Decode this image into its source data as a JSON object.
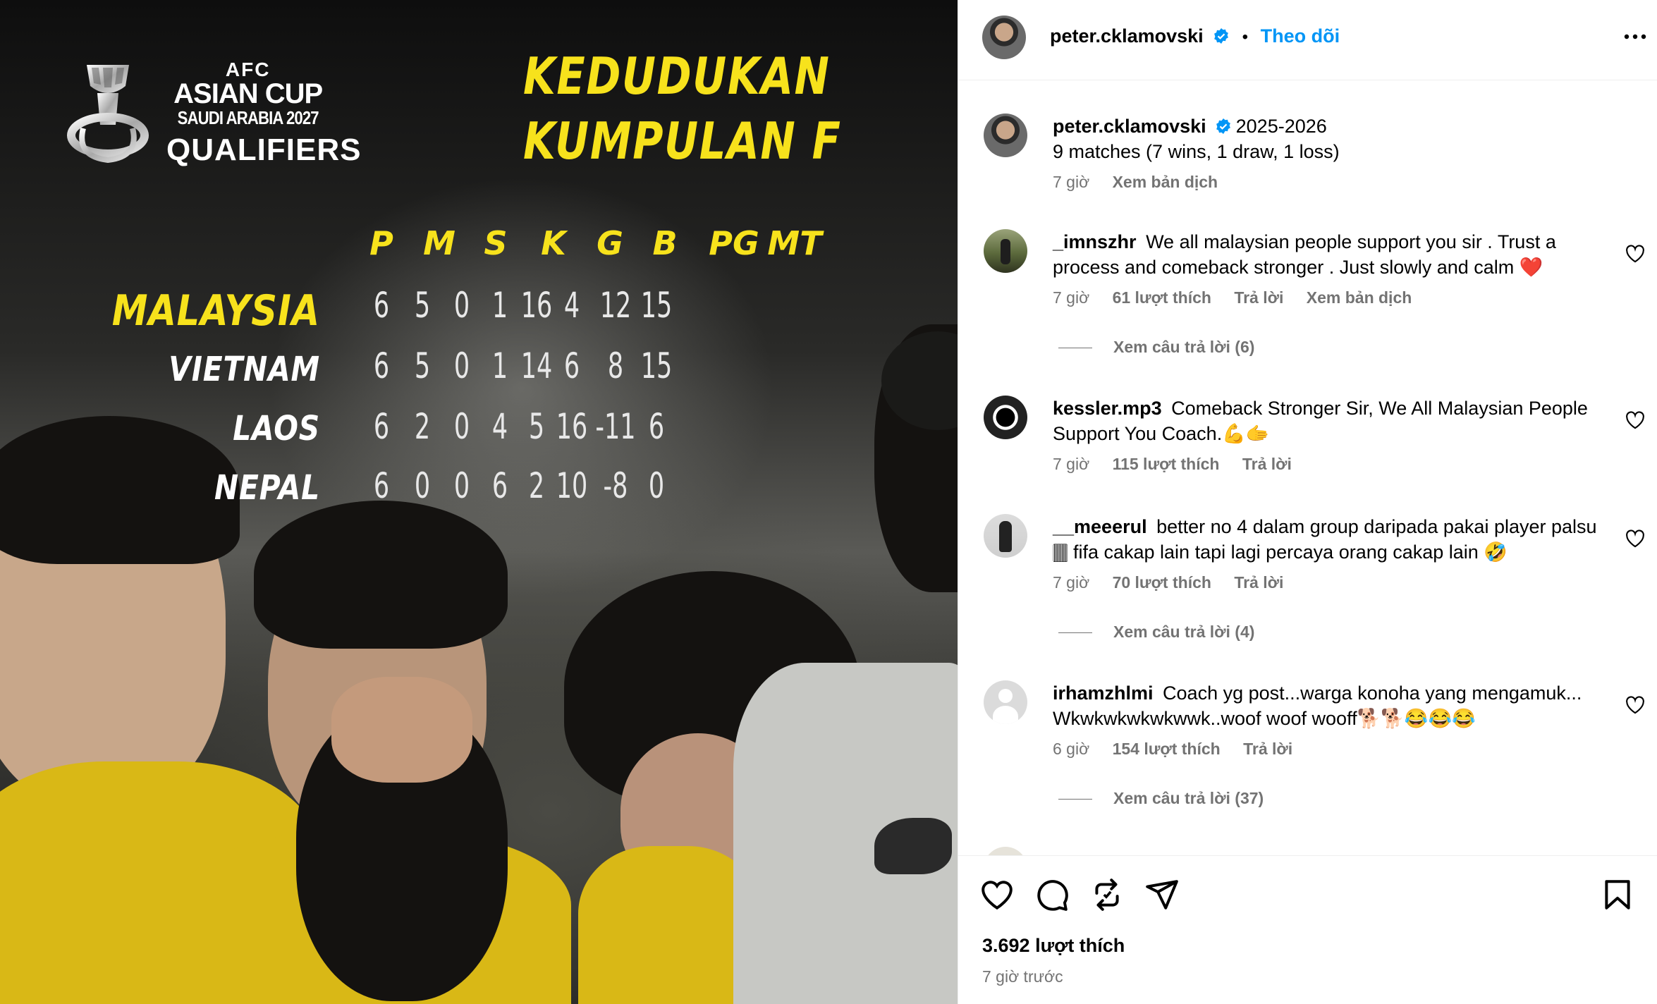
{
  "image": {
    "logo": {
      "afc": "AFC",
      "asian_cup": "ASIAN CUP",
      "host": "SAUDI ARABIA 2027",
      "qualifiers": "QUALIFIERS"
    },
    "headline_1": "KEDUDUKAN",
    "headline_2": "KUMPULAN F",
    "columns": [
      "P",
      "M",
      "S",
      "K",
      "G",
      "B",
      "PG",
      "MT"
    ],
    "rows": [
      {
        "team": "MALAYSIA",
        "values": [
          "6",
          "5",
          "0",
          "1",
          "16",
          "4",
          "12",
          "15"
        ]
      },
      {
        "team": "VIETNAM",
        "values": [
          "6",
          "5",
          "0",
          "1",
          "14",
          "6",
          "8",
          "15"
        ]
      },
      {
        "team": "LAOS",
        "values": [
          "6",
          "2",
          "0",
          "4",
          "5",
          "16",
          "-11",
          "6"
        ]
      },
      {
        "team": "NEPAL",
        "values": [
          "6",
          "0",
          "0",
          "6",
          "2",
          "10",
          "-8",
          "0"
        ]
      }
    ],
    "highlight_color": "#f7e21c"
  },
  "header": {
    "username": "peter.cklamovski",
    "dot": "•",
    "follow_label": "Theo dõi"
  },
  "caption": {
    "username": "peter.cklamovski",
    "line1": "2025-2026",
    "line2": "9 matches (7 wins, 1 draw, 1 loss)",
    "time": "7 giờ",
    "translate": "Xem bản dịch"
  },
  "comments": [
    {
      "username": "_imnszhr",
      "text": "We all malaysian people support you sir . Trust a process and comeback stronger . Just slowly and calm ❤️",
      "time": "7 giờ",
      "likes": "61 lượt thích",
      "reply": "Trả lời",
      "translate": "Xem bản dịch",
      "view_replies": "Xem câu trả lời (6)"
    },
    {
      "username": "kessler.mp3",
      "text": "Comeback Stronger Sir, We All Malaysian People Support You Coach.💪🫱",
      "time": "7 giờ",
      "likes": "115 lượt thích",
      "reply": "Trả lời"
    },
    {
      "username": "__meeerul",
      "text": "better no 4 dalam group daripada pakai player palsu 🀫 fifa cakap lain tapi lagi percaya orang cakap lain 🤣",
      "time": "7 giờ",
      "likes": "70 lượt thích",
      "reply": "Trả lời",
      "view_replies": "Xem câu trả lời (4)"
    },
    {
      "username": "irhamzhlmi",
      "text": "Coach yg post...warga konoha yang mengamuk... Wkwkwkwkwkwwk..woof woof wooff🐕🐕😂😂😂",
      "time": "6 giờ",
      "likes": "154 lượt thích",
      "reply": "Trả lời",
      "view_replies": "Xem câu trả lời (37)"
    }
  ],
  "footer": {
    "likes": "3.692 lượt thích",
    "time": "7 giờ trước"
  },
  "colors": {
    "accent": "#0095f6",
    "muted": "#737373"
  }
}
